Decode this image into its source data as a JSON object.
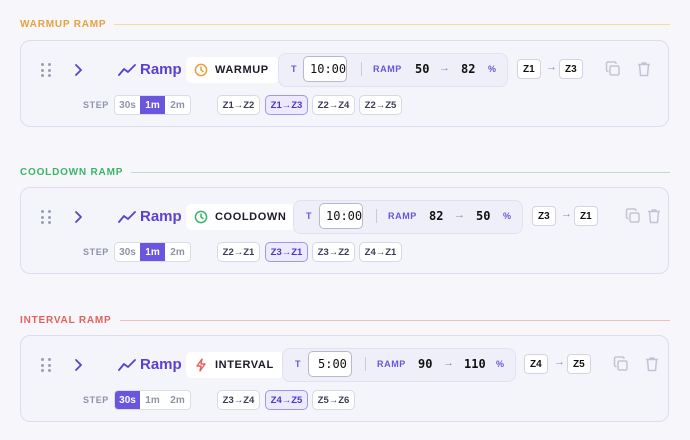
{
  "colors": {
    "warmup": "#e6a23c",
    "cooldown": "#3bb46a",
    "interval": "#e0625b",
    "accent": "#6a55e0",
    "ramp_text": "#5b3fd1"
  },
  "sections": [
    {
      "title": "WARMUP RAMP",
      "icon": "clock-icon",
      "ramp_label": "Ramp",
      "type_label": "WARMUP",
      "t_label": "T",
      "time_value": "10:00",
      "ramp_word": "RAMP",
      "start_pct": "50",
      "arrow": "→",
      "end_pct": "82",
      "pct_unit": "%",
      "zone_from": "Z1",
      "zone_to": "Z3",
      "step_label": "STEP",
      "steps": [
        "30s",
        "1m",
        "2m"
      ],
      "active_step": 1,
      "presets": [
        "Z1→Z2",
        "Z1→Z3",
        "Z2→Z4",
        "Z2→Z5"
      ],
      "active_preset": 1
    },
    {
      "title": "COOLDOWN RAMP",
      "icon": "clock-icon",
      "ramp_label": "Ramp",
      "type_label": "COOLDOWN",
      "t_label": "T",
      "time_value": "10:00",
      "ramp_word": "RAMP",
      "start_pct": "82",
      "arrow": "→",
      "end_pct": "50",
      "pct_unit": "%",
      "zone_from": "Z3",
      "zone_to": "Z1",
      "step_label": "STEP",
      "steps": [
        "30s",
        "1m",
        "2m"
      ],
      "active_step": 1,
      "presets": [
        "Z2→Z1",
        "Z3→Z1",
        "Z3→Z2",
        "Z4→Z1"
      ],
      "active_preset": 1
    },
    {
      "title": "INTERVAL RAMP",
      "icon": "bolt-icon",
      "ramp_label": "Ramp",
      "type_label": "INTERVAL",
      "t_label": "T",
      "time_value": "5:00",
      "ramp_word": "RAMP",
      "start_pct": "90",
      "arrow": "→",
      "end_pct": "110",
      "pct_unit": "%",
      "zone_from": "Z4",
      "zone_to": "Z5",
      "step_label": "STEP",
      "steps": [
        "30s",
        "1m",
        "2m"
      ],
      "active_step": 0,
      "presets": [
        "Z3→Z4",
        "Z4→Z5",
        "Z5→Z6"
      ],
      "active_preset": 1
    }
  ]
}
